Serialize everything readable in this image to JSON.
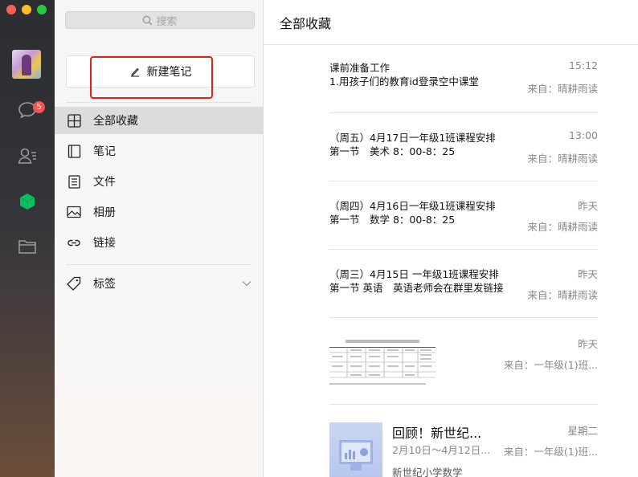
{
  "window": {
    "controls": [
      "close",
      "minimize",
      "zoom"
    ]
  },
  "rail": {
    "icons": [
      "chat-icon",
      "contacts-icon",
      "favorites-cube-icon",
      "folder-icon"
    ],
    "chat_badge": "5",
    "accent_color": "#07c160"
  },
  "sidebar": {
    "search_placeholder": "搜索",
    "new_note_label": "新建笔记",
    "items": [
      {
        "label": "全部收藏",
        "icon": "grid-icon",
        "active": true
      },
      {
        "label": "笔记",
        "icon": "notebook-icon"
      },
      {
        "label": "文件",
        "icon": "file-icon"
      },
      {
        "label": "相册",
        "icon": "image-icon"
      },
      {
        "label": "链接",
        "icon": "link-icon"
      }
    ],
    "tags_label": "标签"
  },
  "content": {
    "title": "全部收藏",
    "items": [
      {
        "line1": "课前准备工作",
        "line2": "1.用孩子们的教育id登录空中课堂",
        "time": "15:12",
        "source": "来自：晴耕雨读"
      },
      {
        "line1": "（周五）4月17日一年级1班课程安排",
        "line2": "第一节　美术 8：00-8：25",
        "time": "13:00",
        "source": "来自：晴耕雨读"
      },
      {
        "line1": "（周四）4月16日一年级1班课程安排",
        "line2": "第一节　数学 8：00-8：25",
        "time": "昨天",
        "source": "来自：晴耕雨读"
      },
      {
        "line1": "（周三）4月15日  一年级1班课程安排",
        "line2": "第一节 英语　英语老师会在群里发链接",
        "time": "昨天",
        "source": "来自：晴耕雨读"
      },
      {
        "time": "昨天",
        "source": "来自：一年级(1)班..."
      },
      {
        "title": "回顾！新世纪...",
        "subtitle": "2月10日～4月12日...",
        "footer": "新世纪小学数学",
        "time": "星期二",
        "source": "来自：一年级(1)班..."
      }
    ]
  }
}
